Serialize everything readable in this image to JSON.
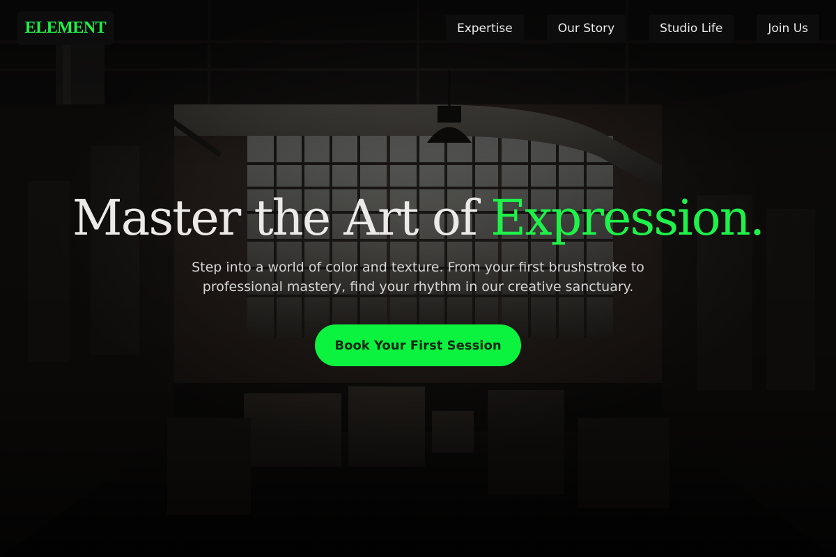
{
  "brand": {
    "logo_text": "ELEMENT",
    "accent_color": "#1ef24a"
  },
  "nav": {
    "items": [
      {
        "label": "Expertise"
      },
      {
        "label": "Our Story"
      },
      {
        "label": "Studio Life"
      },
      {
        "label": "Join Us"
      }
    ]
  },
  "hero": {
    "headline_main": "Master the Art of ",
    "headline_accent": "Expression.",
    "subtitle": "Step into a world of color and texture. From your first brushstroke to professional mastery, find your rhythm in our creative sanctuary.",
    "cta_label": "Book Your First Session",
    "cta_color": "#0bf23f",
    "background_image": "dark industrial art studio with tall windows, ducts, pendant lamp and stacked canvases"
  }
}
